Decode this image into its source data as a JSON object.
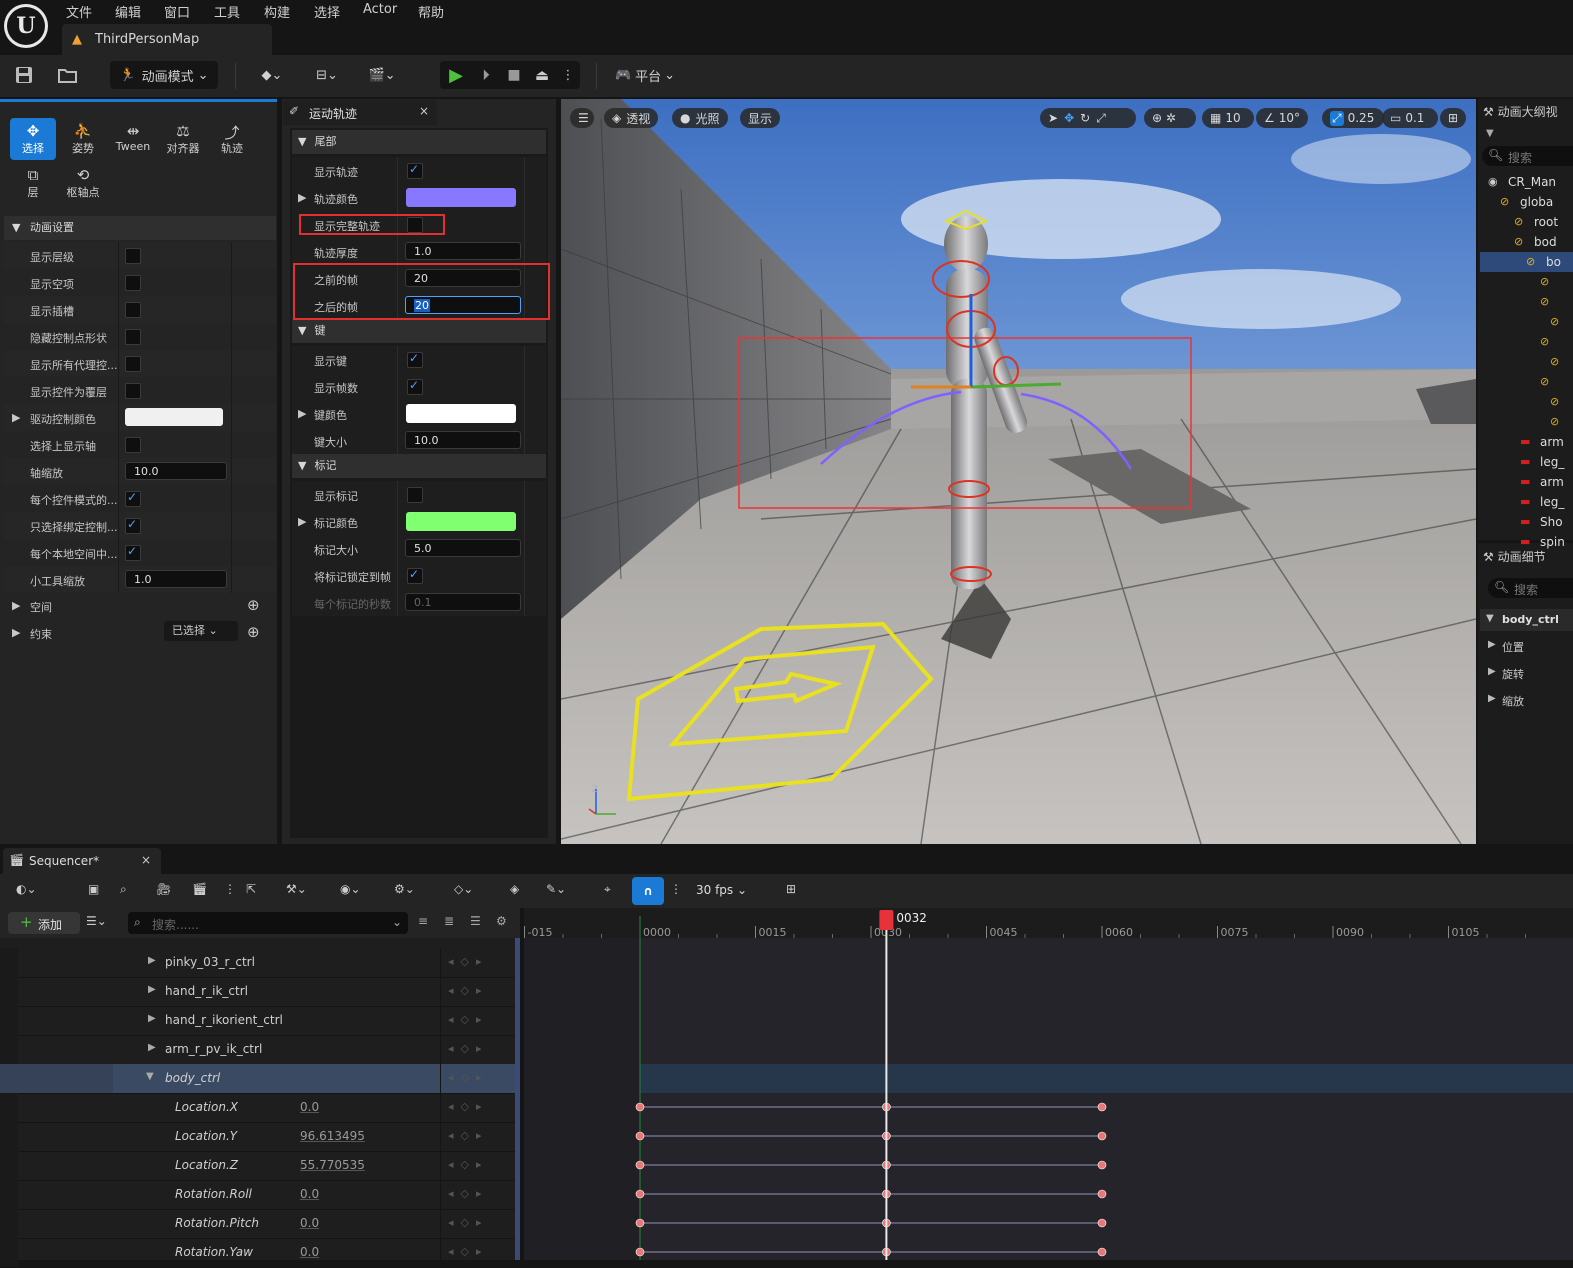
{
  "menu": {
    "items": [
      "文件",
      "编辑",
      "窗口",
      "工具",
      "构建",
      "选择",
      "Actor",
      "帮助"
    ],
    "map_tab": "ThirdPersonMap"
  },
  "toolbar": {
    "mode": "动画模式",
    "platform": "平台"
  },
  "left_panel": {
    "modes": [
      {
        "label": "选择",
        "icon": "select-mode-icon"
      },
      {
        "label": "姿势",
        "icon": "pose-mode-icon"
      },
      {
        "label": "Tween",
        "icon": "tween-mode-icon"
      },
      {
        "label": "对齐器",
        "icon": "aligner-mode-icon"
      },
      {
        "label": "轨迹",
        "icon": "trail-mode-icon"
      },
      {
        "label": "层",
        "icon": "layer-mode-icon"
      },
      {
        "label": "枢轴点",
        "icon": "pivot-mode-icon"
      }
    ],
    "section_title": "动画设置",
    "props": [
      {
        "label": "显示层级",
        "type": "check",
        "value": false
      },
      {
        "label": "显示空项",
        "type": "check",
        "value": false
      },
      {
        "label": "显示插槽",
        "type": "check",
        "value": false
      },
      {
        "label": "隐藏控制点形状",
        "type": "check",
        "value": false
      },
      {
        "label": "显示所有代理控...",
        "type": "check",
        "value": false
      },
      {
        "label": "显示控件为覆层",
        "type": "check",
        "value": false
      },
      {
        "label": "驱动控制颜色",
        "type": "color",
        "value": "#f0f0f0"
      },
      {
        "label": "选择上显示轴",
        "type": "check",
        "value": false
      },
      {
        "label": "轴缩放",
        "type": "num",
        "value": "10.0"
      },
      {
        "label": "每个控件模式的...",
        "type": "check",
        "value": true
      },
      {
        "label": "只选择绑定控制...",
        "type": "check",
        "value": true
      },
      {
        "label": "每个本地空间中...",
        "type": "check",
        "value": true
      },
      {
        "label": "小工具缩放",
        "type": "num",
        "value": "1.0"
      }
    ],
    "space_label": "空间",
    "constraint_label": "约束",
    "constraint_value": "已选择"
  },
  "motion_trail": {
    "tab_title": "运动轨迹",
    "sections": [
      {
        "title": "尾部",
        "rows": [
          {
            "label": "显示轨迹",
            "type": "check",
            "value": true,
            "expand": false
          },
          {
            "label": "轨迹颜色",
            "type": "color",
            "value": "#8877ff",
            "expand": true
          },
          {
            "label": "显示完整轨迹",
            "type": "check",
            "value": false,
            "expand": false,
            "hl": true
          },
          {
            "label": "轨迹厚度",
            "type": "num",
            "value": "1.0",
            "expand": false
          },
          {
            "label": "之前的帧",
            "type": "num",
            "value": "20",
            "expand": false,
            "hl2": true
          },
          {
            "label": "之后的帧",
            "type": "num",
            "value": "20",
            "expand": false,
            "hl2": true,
            "active": true
          }
        ]
      },
      {
        "title": "键",
        "rows": [
          {
            "label": "显示键",
            "type": "check",
            "value": true,
            "expand": false
          },
          {
            "label": "显示帧数",
            "type": "check",
            "value": true,
            "expand": false
          },
          {
            "label": "键颜色",
            "type": "color",
            "value": "#ffffff",
            "expand": true
          },
          {
            "label": "键大小",
            "type": "num",
            "value": "10.0",
            "expand": false
          }
        ]
      },
      {
        "title": "标记",
        "rows": [
          {
            "label": "显示标记",
            "type": "check",
            "value": false,
            "expand": false
          },
          {
            "label": "标记颜色",
            "type": "color",
            "value": "#80ff70",
            "expand": true
          },
          {
            "label": "标记大小",
            "type": "num",
            "value": "5.0",
            "expand": false
          },
          {
            "label": "将标记锁定到帧",
            "type": "check",
            "value": true,
            "expand": false
          },
          {
            "label": "每个标记的秒数",
            "type": "num",
            "value": "0.1",
            "expand": false,
            "disabled": true
          }
        ]
      }
    ]
  },
  "viewport": {
    "pills": [
      "透视",
      "光照",
      "显示"
    ],
    "grid_snap": "10",
    "rot_snap": "10°",
    "scale_snap": "0.25",
    "cam_speed": "0.1"
  },
  "outliner": {
    "title": "动画大纲视",
    "search": "搜索",
    "items": [
      "CR_Man",
      "globa",
      "root",
      "bod",
      "bo",
      "",
      "",
      "",
      "",
      "",
      "",
      "",
      "",
      "arm",
      "leg_",
      "arm",
      "leg_",
      "Sho",
      "spin"
    ]
  },
  "details": {
    "title": "动画细节",
    "search": "搜索",
    "selected": "body_ctrl",
    "groups": [
      "位置",
      "旋转",
      "缩放"
    ]
  },
  "sequencer": {
    "tab": "Sequencer*",
    "add": "添加",
    "search_placeholder": "搜索......",
    "fps": "30 fps",
    "playhead": "0032",
    "ticks": [
      "-015",
      "0000",
      "0015",
      "0030",
      "0045",
      "0060",
      "0075",
      "0090",
      "0105"
    ],
    "tracks": [
      {
        "name": "pinky_03_r_ctrl",
        "value": "",
        "indent": 1
      },
      {
        "name": "hand_r_ik_ctrl",
        "value": "",
        "indent": 1
      },
      {
        "name": "hand_r_ikorient_ctrl",
        "value": "",
        "indent": 1
      },
      {
        "name": "arm_r_pv_ik_ctrl",
        "value": "",
        "indent": 1
      },
      {
        "name": "body_ctrl",
        "value": "",
        "indent": 1,
        "selected": true
      },
      {
        "name": "Location.X",
        "value": "0.0",
        "indent": 2
      },
      {
        "name": "Location.Y",
        "value": "96.613495",
        "indent": 2
      },
      {
        "name": "Location.Z",
        "value": "55.770535",
        "indent": 2
      },
      {
        "name": "Rotation.Roll",
        "value": "0.0",
        "indent": 2
      },
      {
        "name": "Rotation.Pitch",
        "value": "0.0",
        "indent": 2
      },
      {
        "name": "Rotation.Yaw",
        "value": "0.0",
        "indent": 2
      }
    ],
    "key_frames": [
      0,
      32,
      60
    ]
  }
}
